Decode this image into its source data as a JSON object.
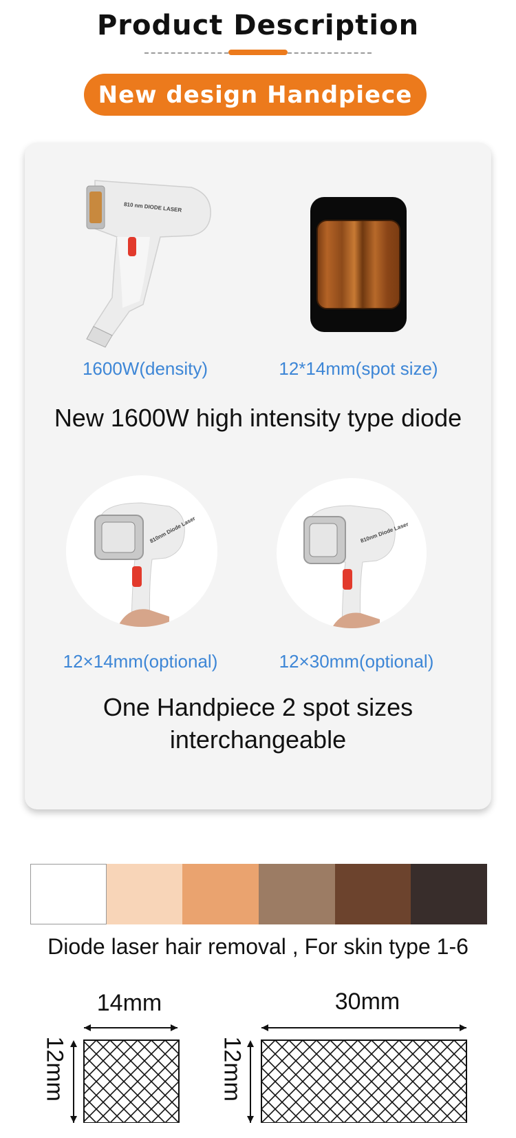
{
  "header": {
    "title": "Product Description",
    "pill_label": "New design Handpiece",
    "accent_color": "#ec7a1c"
  },
  "card": {
    "device_label": "810 nm DIODE LASER",
    "label_density": "1600W(density)",
    "label_spot": "12*14mm(spot size)",
    "headline": "New 1600W high intensity type diode",
    "handpiece_label": "810nm Diode Laser",
    "label_optional_a": "12×14mm(optional)",
    "label_optional_b": "12×30mm(optional)",
    "caption_line1": "One Handpiece 2 spot sizes",
    "caption_line2": "interchangeable"
  },
  "skin": {
    "colors": [
      "#ffffff",
      "#f8d5b8",
      "#eaa36f",
      "#9c7c64",
      "#6c432d",
      "#382d2b"
    ],
    "caption": "Diode laser hair removal , For skin type 1-6"
  },
  "spots": {
    "small": {
      "width_label": "14mm",
      "height_label": "12mm"
    },
    "large": {
      "width_label": "30mm",
      "height_label": "12mm"
    }
  }
}
